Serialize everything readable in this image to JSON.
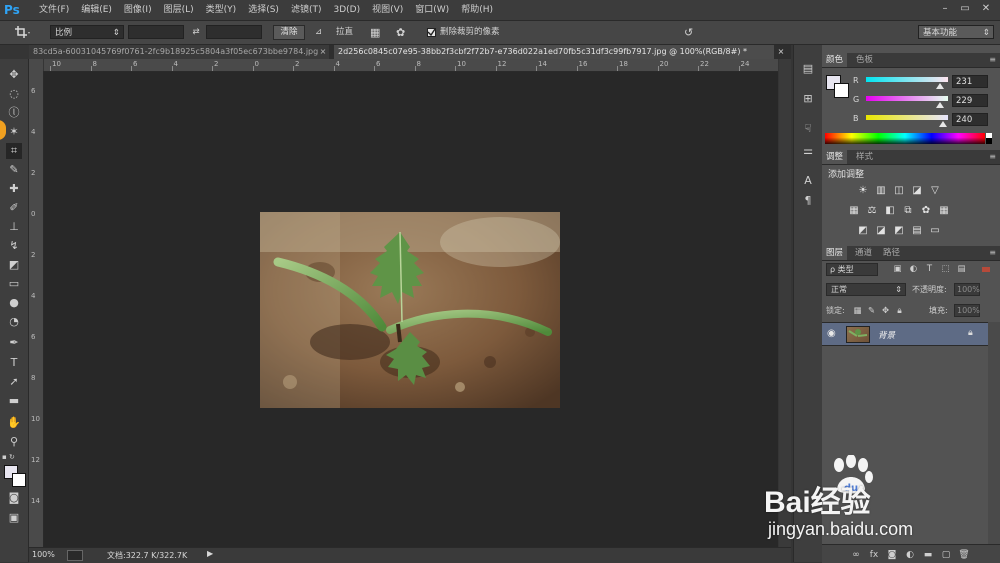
{
  "app": {
    "logo": "Ps"
  },
  "menu": [
    "文件(F)",
    "编辑(E)",
    "图像(I)",
    "图层(L)",
    "类型(Y)",
    "选择(S)",
    "滤镜(T)",
    "3D(D)",
    "视图(V)",
    "窗口(W)",
    "帮助(H)"
  ],
  "window_controls": {
    "minimize": "–",
    "restore": "▭",
    "close": "✕"
  },
  "options": {
    "ratio_select": "比例",
    "clear_button": "清除",
    "straighten_label": "拉直",
    "delete_cropped_label": "删除裁剪的像素",
    "delete_cropped_checked": true,
    "workspace_select": "基本功能"
  },
  "tabs": [
    {
      "label": "83cd5a-60031045769f0761-2fc9b18925c5804a3f05ec673bbe9784.jpg",
      "active": false
    },
    {
      "label": "2d256c0845c07e95-38bb2f3cbf2f72b7-e736d022a1ed70fb5c31df3c99fb7917.jpg @ 100%(RGB/8#) *",
      "active": true
    }
  ],
  "ruler": {
    "top": [
      "10",
      "8",
      "6",
      "4",
      "2",
      "0",
      "2",
      "4",
      "6",
      "8",
      "10",
      "12",
      "14",
      "16",
      "18",
      "20",
      "22",
      "24"
    ],
    "left": [
      "6",
      "4",
      "2",
      "0",
      "2",
      "4",
      "6",
      "8",
      "10",
      "12",
      "14"
    ]
  },
  "status": {
    "zoom": "100%",
    "doc_info": "文档:322.7 K/322.7K"
  },
  "color_panel": {
    "tabs": [
      "颜色",
      "色板"
    ],
    "channels": [
      {
        "name": "R",
        "value": "231",
        "fraction": 0.906
      },
      {
        "name": "G",
        "value": "229",
        "fraction": 0.898
      },
      {
        "name": "B",
        "value": "240",
        "fraction": 0.941
      }
    ],
    "foreground": "#e7e5f0"
  },
  "adjust_panel": {
    "tabs": [
      "调整",
      "样式"
    ],
    "title": "添加调整"
  },
  "layers_panel": {
    "tabs": [
      "图层",
      "通道",
      "路径"
    ],
    "filter_label": "ρ 类型",
    "blend_mode": "正常",
    "opacity_label": "不透明度:",
    "opacity_value": "100%",
    "lock_label": "锁定:",
    "fill_label": "填充:",
    "fill_value": "100%",
    "layers": [
      {
        "name": "背景",
        "visible": true,
        "locked": true,
        "selected": true
      }
    ]
  },
  "watermark": {
    "brand": "Bai经验",
    "url": "jingyan.baidu.com"
  },
  "colors": {
    "accent": "#2fa3f5",
    "selected_layer": "#5e6b85",
    "workspace": "#282828"
  }
}
